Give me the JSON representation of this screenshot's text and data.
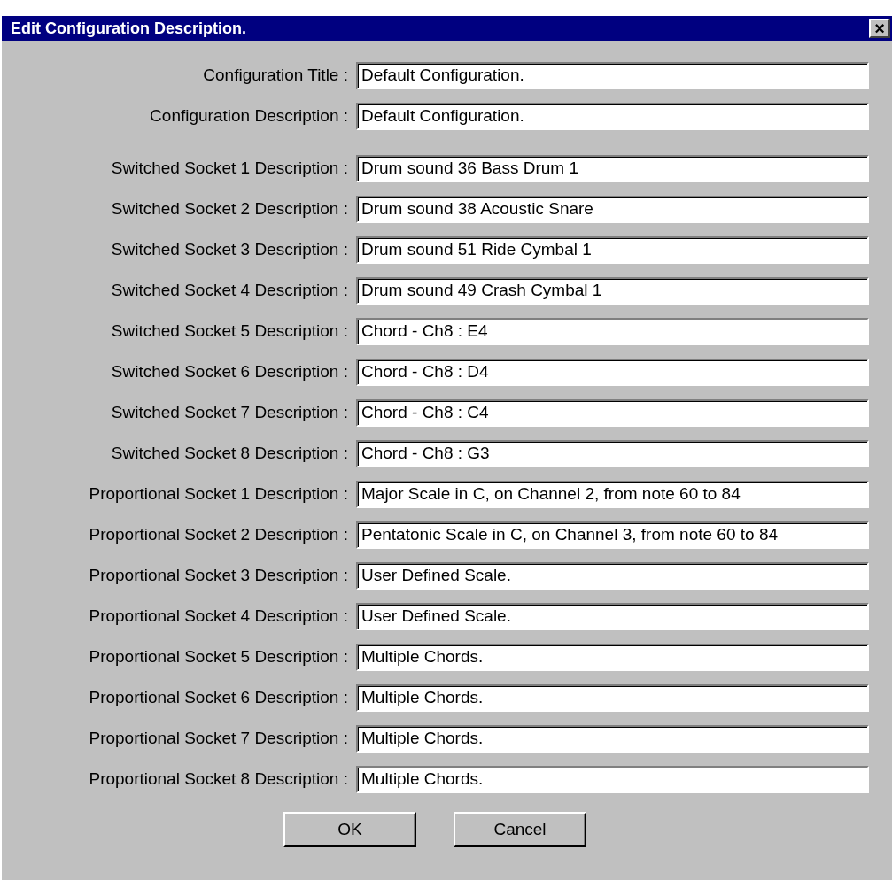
{
  "window": {
    "title": "Edit Configuration Description.",
    "close_label": "×"
  },
  "general_fields": [
    {
      "label": "Configuration Title :",
      "value": "Default Configuration."
    },
    {
      "label": "Configuration Description :",
      "value": "Default Configuration."
    }
  ],
  "socket_fields": [
    {
      "label": "Switched Socket 1 Description :",
      "value": "Drum sound 36 Bass Drum 1"
    },
    {
      "label": "Switched Socket 2 Description :",
      "value": "Drum sound 38 Acoustic Snare"
    },
    {
      "label": "Switched Socket 3 Description :",
      "value": "Drum sound 51 Ride Cymbal 1"
    },
    {
      "label": "Switched Socket 4 Description :",
      "value": "Drum sound 49 Crash Cymbal 1"
    },
    {
      "label": "Switched Socket 5 Description :",
      "value": "Chord - Ch8 : E4"
    },
    {
      "label": "Switched Socket 6 Description :",
      "value": "Chord - Ch8 : D4"
    },
    {
      "label": "Switched Socket 7 Description :",
      "value": "Chord - Ch8 : C4"
    },
    {
      "label": "Switched Socket 8 Description :",
      "value": "Chord - Ch8 : G3"
    },
    {
      "label": "Proportional Socket 1 Description :",
      "value": "Major Scale in C, on Channel 2, from note 60 to 84"
    },
    {
      "label": "Proportional Socket 2 Description :",
      "value": "Pentatonic Scale in C, on Channel 3, from note 60 to 84"
    },
    {
      "label": "Proportional Socket 3 Description :",
      "value": "User Defined Scale."
    },
    {
      "label": "Proportional Socket 4 Description :",
      "value": "User Defined Scale."
    },
    {
      "label": "Proportional Socket 5 Description :",
      "value": "Multiple Chords."
    },
    {
      "label": "Proportional Socket 6 Description :",
      "value": "Multiple Chords."
    },
    {
      "label": "Proportional Socket 7 Description :",
      "value": "Multiple Chords."
    },
    {
      "label": "Proportional Socket 8 Description :",
      "value": "Multiple Chords."
    }
  ],
  "buttons": [
    "OK",
    "Cancel"
  ]
}
